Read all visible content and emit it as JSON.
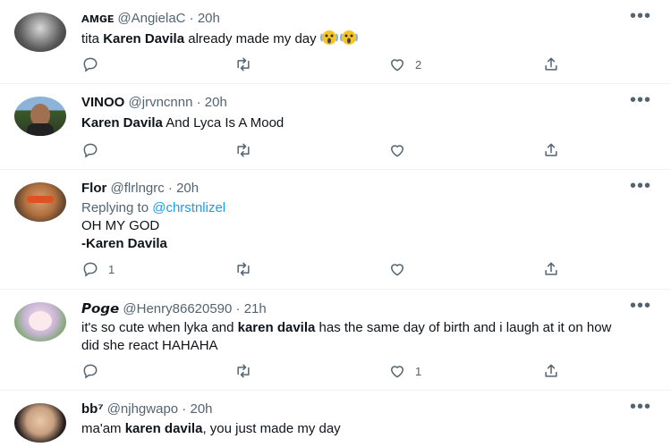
{
  "tweets": [
    {
      "name": "ᴀᴍɢᴇ",
      "handle": "@AngielaC",
      "time": "20h",
      "text_pre": "tita ",
      "text_bold": "Karen Davila",
      "text_post": " already made my day",
      "emoji": "scream-emoji",
      "reply_count": "",
      "retweet_count": "",
      "like_count": "2"
    },
    {
      "name": "VINOO",
      "handle": "@jrvncnnn",
      "time": "20h",
      "text_bold": "Karen Davila",
      "text_post": " And Lyca Is A Mood",
      "reply_count": "",
      "retweet_count": "",
      "like_count": ""
    },
    {
      "name": "Flor",
      "handle": "@flrlngrc",
      "time": "20h",
      "replying_label": "Replying to ",
      "replying_handle": "@chrstnlizel",
      "line1": "OH MY GOD",
      "line2": "-Karen Davila",
      "reply_count": "1",
      "retweet_count": "",
      "like_count": ""
    },
    {
      "name": "𝙋𝙤𝙜𝙚",
      "handle": "@Henry86620590",
      "time": "21h",
      "text_pre": "it's so cute when lyka and ",
      "text_bold": "karen davila",
      "text_post": " has the same day of birth and i laugh at it on how did she react HAHAHA",
      "reply_count": "",
      "retweet_count": "",
      "like_count": "1"
    },
    {
      "name": "bb⁷",
      "handle": "@njhgwapo",
      "time": "20h",
      "text_pre": "ma'am ",
      "text_bold": "karen davila",
      "text_post": ", you just made my day"
    }
  ],
  "separator": " · ",
  "more_glyph": "•••",
  "colors": {
    "text": "#0f1419",
    "secondary": "#536471",
    "link": "#1d9bf0",
    "divider": "#eff3f4"
  }
}
